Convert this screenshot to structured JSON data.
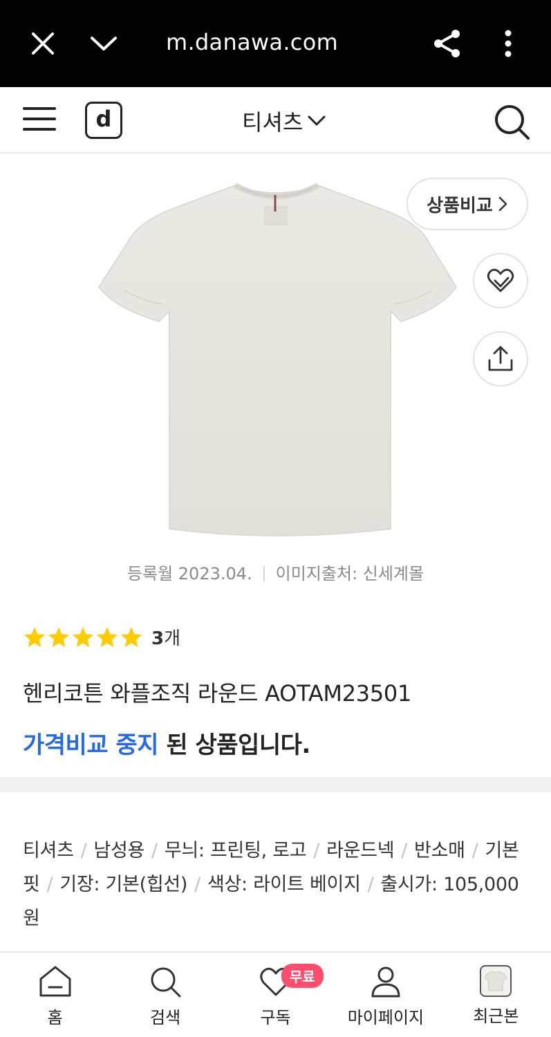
{
  "browser": {
    "url": "m.danawa.com",
    "icons": [
      "close-icon",
      "chevron-down-icon",
      "share-icon",
      "more-vertical-icon"
    ]
  },
  "header": {
    "logo_letter": "d",
    "title": "티셔츠",
    "icons": [
      "hamburger-menu-icon",
      "search-icon",
      "chevron-down-icon"
    ]
  },
  "product": {
    "compare_label": "상품비교",
    "registered": "등록월 2023.04.",
    "image_source": "이미지출처: 신세계몰",
    "rating_stars": 5,
    "review_count": "3",
    "review_unit": "개",
    "name": "헨리코튼 와플조직 라운드 AOTAM23501",
    "status_highlight": "가격비교 중지",
    "status_rest": " 된 상품입니다.",
    "specs": [
      "티셔츠",
      "남성용",
      "무늬: 프린팅, 로고",
      "라운드넥",
      "반소매",
      "기본핏",
      "기장: 기본(힙선)",
      "색상: 라이트 베이지",
      "출시가: 105,000원"
    ]
  },
  "colors": {
    "accent_blue": "#2469e8",
    "star_yellow": "#ffcc00",
    "badge_pink": "#ff4d6d"
  },
  "bottom_nav": {
    "items": [
      {
        "label": "홈",
        "icon": "home-icon"
      },
      {
        "label": "검색",
        "icon": "search-icon"
      },
      {
        "label": "구독",
        "icon": "heart-icon",
        "badge": "무료"
      },
      {
        "label": "마이페이지",
        "icon": "user-icon"
      },
      {
        "label": "최근본",
        "icon": "recent-thumbnail"
      }
    ]
  }
}
